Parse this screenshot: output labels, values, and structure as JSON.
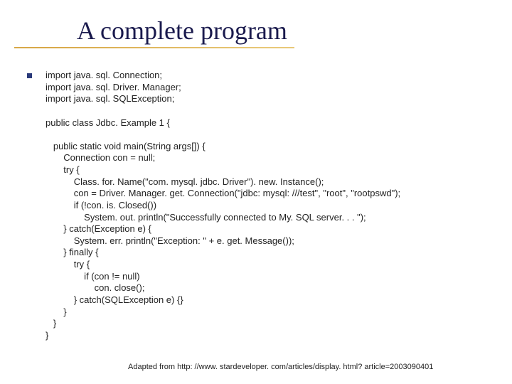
{
  "title": "A complete program",
  "code": {
    "l01": "import java. sql. Connection;",
    "l02": "import java. sql. Driver. Manager;",
    "l03": "import java. sql. SQLException;",
    "l04": "",
    "l05": "public class Jdbc. Example 1 {",
    "l06": "",
    "l07": "   public static void main(String args[]) {",
    "l08": "       Connection con = null;",
    "l09": "       try {",
    "l10": "           Class. for. Name(\"com. mysql. jdbc. Driver\"). new. Instance();",
    "l11": "           con = Driver. Manager. get. Connection(\"jdbc: mysql: ///test\", \"root\", \"rootpswd\");",
    "l12": "           if (!con. is. Closed())",
    "l13": "               System. out. println(\"Successfully connected to My. SQL server. . . \");",
    "l14": "       } catch(Exception e) {",
    "l15": "           System. err. println(\"Exception: \" + e. get. Message());",
    "l16": "       } finally {",
    "l17": "           try {",
    "l18": "               if (con != null)",
    "l19": "                   con. close();",
    "l20": "           } catch(SQLException e) {}",
    "l21": "       }",
    "l22": "   }",
    "l23": "}"
  },
  "attribution": "Adapted from http: //www. stardeveloper. com/articles/display. html? article=2003090401"
}
